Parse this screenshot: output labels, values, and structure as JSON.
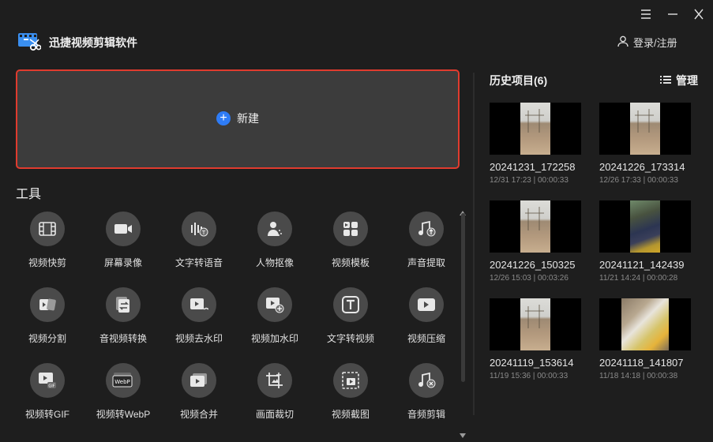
{
  "app": {
    "title": "迅捷视频剪辑软件",
    "login_label": "登录/注册"
  },
  "new_project": {
    "label": "新建"
  },
  "tools": {
    "title": "工具",
    "items": [
      {
        "label": "视频快剪",
        "icon": "film-icon"
      },
      {
        "label": "屏幕录像",
        "icon": "camera-icon"
      },
      {
        "label": "文字转语音",
        "icon": "text-to-speech-icon"
      },
      {
        "label": "人物抠像",
        "icon": "person-cutout-icon"
      },
      {
        "label": "视频模板",
        "icon": "template-icon"
      },
      {
        "label": "声音提取",
        "icon": "audio-extract-icon"
      },
      {
        "label": "视频分割",
        "icon": "video-split-icon"
      },
      {
        "label": "音视频转换",
        "icon": "convert-icon"
      },
      {
        "label": "视频去水印",
        "icon": "remove-watermark-icon"
      },
      {
        "label": "视频加水印",
        "icon": "add-watermark-icon"
      },
      {
        "label": "文字转视频",
        "icon": "text-to-video-icon"
      },
      {
        "label": "视频压缩",
        "icon": "compress-icon"
      },
      {
        "label": "视频转GIF",
        "icon": "gif-icon"
      },
      {
        "label": "视频转WebP",
        "icon": "webp-icon"
      },
      {
        "label": "视频合并",
        "icon": "merge-icon"
      },
      {
        "label": "画面裁切",
        "icon": "crop-icon"
      },
      {
        "label": "视频截图",
        "icon": "screenshot-icon"
      },
      {
        "label": "音频剪辑",
        "icon": "audio-cut-icon"
      }
    ]
  },
  "history": {
    "title": "历史项目(6)",
    "manage_label": "管理",
    "projects": [
      {
        "name": "20241231_172258",
        "meta": "12/31 17:23 | 00:00:33",
        "thumb": "field"
      },
      {
        "name": "20241226_173314",
        "meta": "12/26 17:33 | 00:00:33",
        "thumb": "field"
      },
      {
        "name": "20241226_150325",
        "meta": "12/26 15:03 | 00:03:26",
        "thumb": "field"
      },
      {
        "name": "20241121_142439",
        "meta": "11/21 14:24 | 00:00:28",
        "thumb": "bus"
      },
      {
        "name": "20241119_153614",
        "meta": "11/19 15:36 | 00:00:33",
        "thumb": "field"
      },
      {
        "name": "20241118_141807",
        "meta": "11/18 14:18 | 00:00:38",
        "thumb": "desk"
      }
    ]
  },
  "colors": {
    "accent": "#2e7cf6",
    "highlight_border": "#e03b2e",
    "background": "#1e1e1e"
  }
}
